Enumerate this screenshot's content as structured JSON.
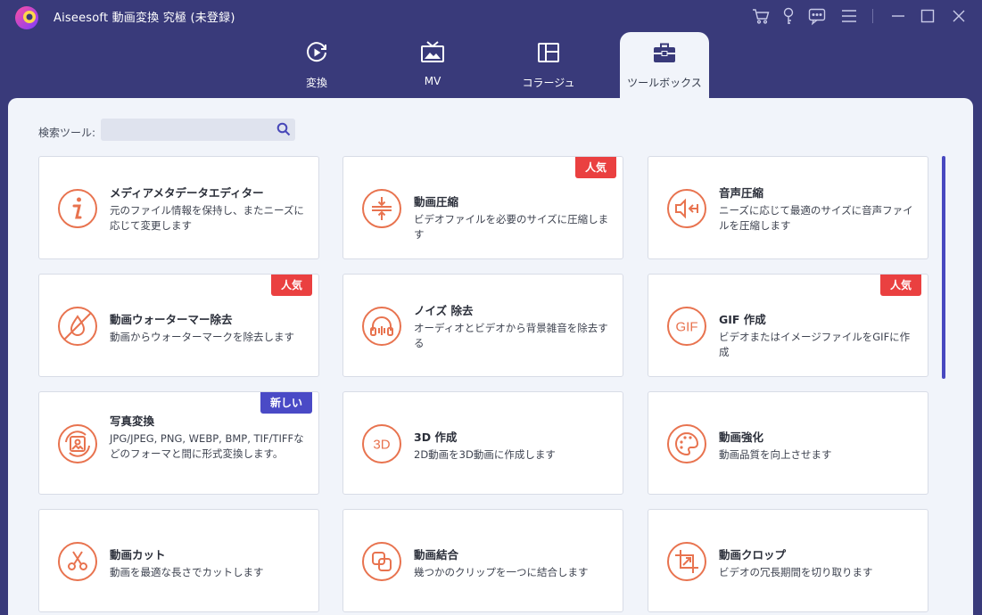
{
  "window": {
    "title": "Aiseesoft 動画変換 究極 (未登録)"
  },
  "tabs": [
    {
      "label": "変換",
      "icon": "convert-icon"
    },
    {
      "label": "MV",
      "icon": "mv-icon"
    },
    {
      "label": "コラージュ",
      "icon": "collage-icon"
    },
    {
      "label": "ツールボックス",
      "icon": "toolbox-icon",
      "active": true
    }
  ],
  "search": {
    "label": "検索ツール:",
    "value": "",
    "placeholder": ""
  },
  "badges": {
    "popular": "人気",
    "new": "新しい"
  },
  "tools": [
    {
      "title": "メディアメタデータエディター",
      "desc": "元のファイル情報を保持し、またニーズに応じて変更します",
      "icon": "info-icon",
      "badge": null
    },
    {
      "title": "動画圧縮",
      "desc": "ビデオファイルを必要のサイズに圧縮します",
      "icon": "compress-icon",
      "badge": "popular"
    },
    {
      "title": "音声圧縮",
      "desc": "ニーズに応じて最適のサイズに音声ファイルを圧縮します",
      "icon": "audio-compress-icon",
      "badge": null
    },
    {
      "title": "動画ウォーターマー除去",
      "desc": "動画からウォーターマークを除去します",
      "icon": "watermark-remove-icon",
      "badge": "popular"
    },
    {
      "title": "ノイズ 除去",
      "desc": "オーディオとビデオから背景雑音を除去する",
      "icon": "noise-remove-icon",
      "badge": null
    },
    {
      "title": "GIF 作成",
      "desc": "ビデオまたはイメージファイルをGIFに作成",
      "icon": "gif-icon",
      "badge": "popular"
    },
    {
      "title": "写真変換",
      "desc": "JPG/JPEG, PNG, WEBP, BMP, TIF/TIFFなどのフォーマと間に形式変換します。",
      "icon": "photo-convert-icon",
      "badge": "new"
    },
    {
      "title": "3D 作成",
      "desc": "2D動画を3D動画に作成します",
      "icon": "3d-icon",
      "badge": null
    },
    {
      "title": "動画強化",
      "desc": "動画品質を向上させます",
      "icon": "palette-icon",
      "badge": null
    },
    {
      "title": "動画カット",
      "desc": "動画を最適な長さでカットします",
      "icon": "scissors-icon",
      "badge": null
    },
    {
      "title": "動画結合",
      "desc": "幾つかのクリップを一つに結合します",
      "icon": "merge-icon",
      "badge": null
    },
    {
      "title": "動画クロップ",
      "desc": "ビデオの冗長期間を切り取ります",
      "icon": "crop-icon",
      "badge": null
    }
  ],
  "colors": {
    "titlebar": "#393a7a",
    "panel": "#f1f4fa",
    "accent": "#e8734f",
    "popular_badge": "#ea4040",
    "new_badge": "#4a4ac6",
    "scrollbar": "#4848c0"
  }
}
